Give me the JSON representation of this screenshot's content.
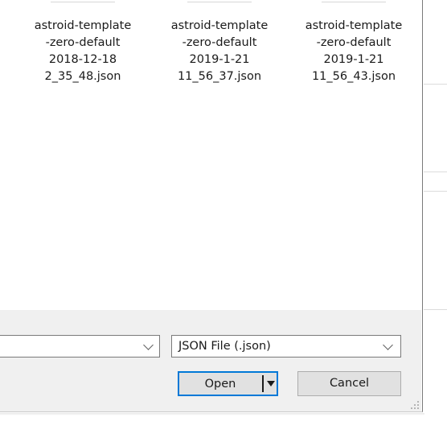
{
  "files": [
    {
      "name_lines": [
        "astroid-template",
        "-zero-default",
        "2018-12-18",
        "2_35_48.json"
      ]
    },
    {
      "name_lines": [
        "astroid-template",
        "-zero-default",
        "2019-1-21",
        "11_56_37.json"
      ]
    },
    {
      "name_lines": [
        "astroid-template",
        "-zero-default",
        "2019-1-21",
        "11_56_43.json"
      ]
    }
  ],
  "file_name_input": {
    "value": "",
    "icon": "chevron-down-icon"
  },
  "file_type": {
    "selected": "JSON File (.json)",
    "icon": "chevron-down-icon"
  },
  "buttons": {
    "open_label": "Open",
    "open_dropdown_icon": "triangle-down-icon",
    "cancel_label": "Cancel"
  },
  "colors": {
    "accent": "#0078d7",
    "panel_bg": "#f0f0f0",
    "button_bg": "#e1e1e1"
  }
}
